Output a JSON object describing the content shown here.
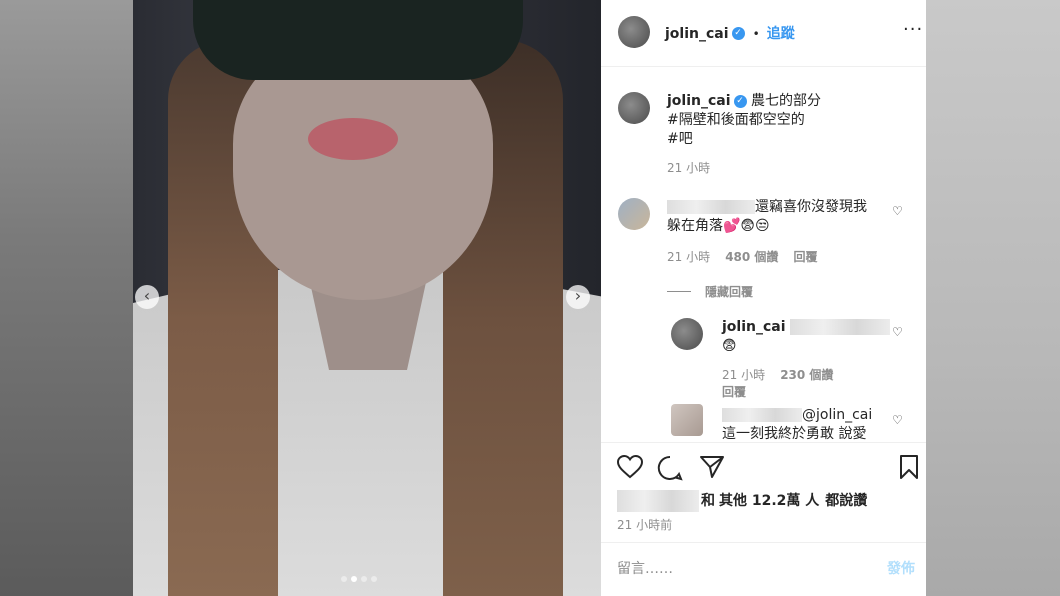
{
  "post": {
    "username": "jolin_cai",
    "follow_label": "追蹤",
    "separator": "•",
    "more_icon": "more-horizontal-icon"
  },
  "caption": {
    "username": "jolin_cai",
    "line1": "農七的部分",
    "line2": "#隔壁和後面都空空的",
    "line3": "#吧",
    "time": "21 小時"
  },
  "comments": [
    {
      "text_line1": "還竊喜你沒發現我",
      "text_line2": "躲在角落💕😨😒",
      "time": "21 小時",
      "likes": "480 個讚",
      "reply": "回覆",
      "hide_replies": "隱藏回覆"
    }
  ],
  "reply": {
    "username": "jolin_cai",
    "emoji": "😨",
    "time": "21 小時",
    "likes": "230 個讚",
    "reply": "回覆"
  },
  "comment3": {
    "mention": "@jolin_cai",
    "text": "這一刻我終於勇敢 說愛"
  },
  "likes_line": {
    "prefix": "和",
    "others": "其他 12.2萬 人",
    "suffix": "都說讚"
  },
  "post_time": "21 小時前",
  "comment_box": {
    "placeholder": "留言……",
    "submit": "發佈"
  },
  "colors": {
    "link": "#3897f0",
    "text": "#262626",
    "muted": "#8e8e8e"
  }
}
